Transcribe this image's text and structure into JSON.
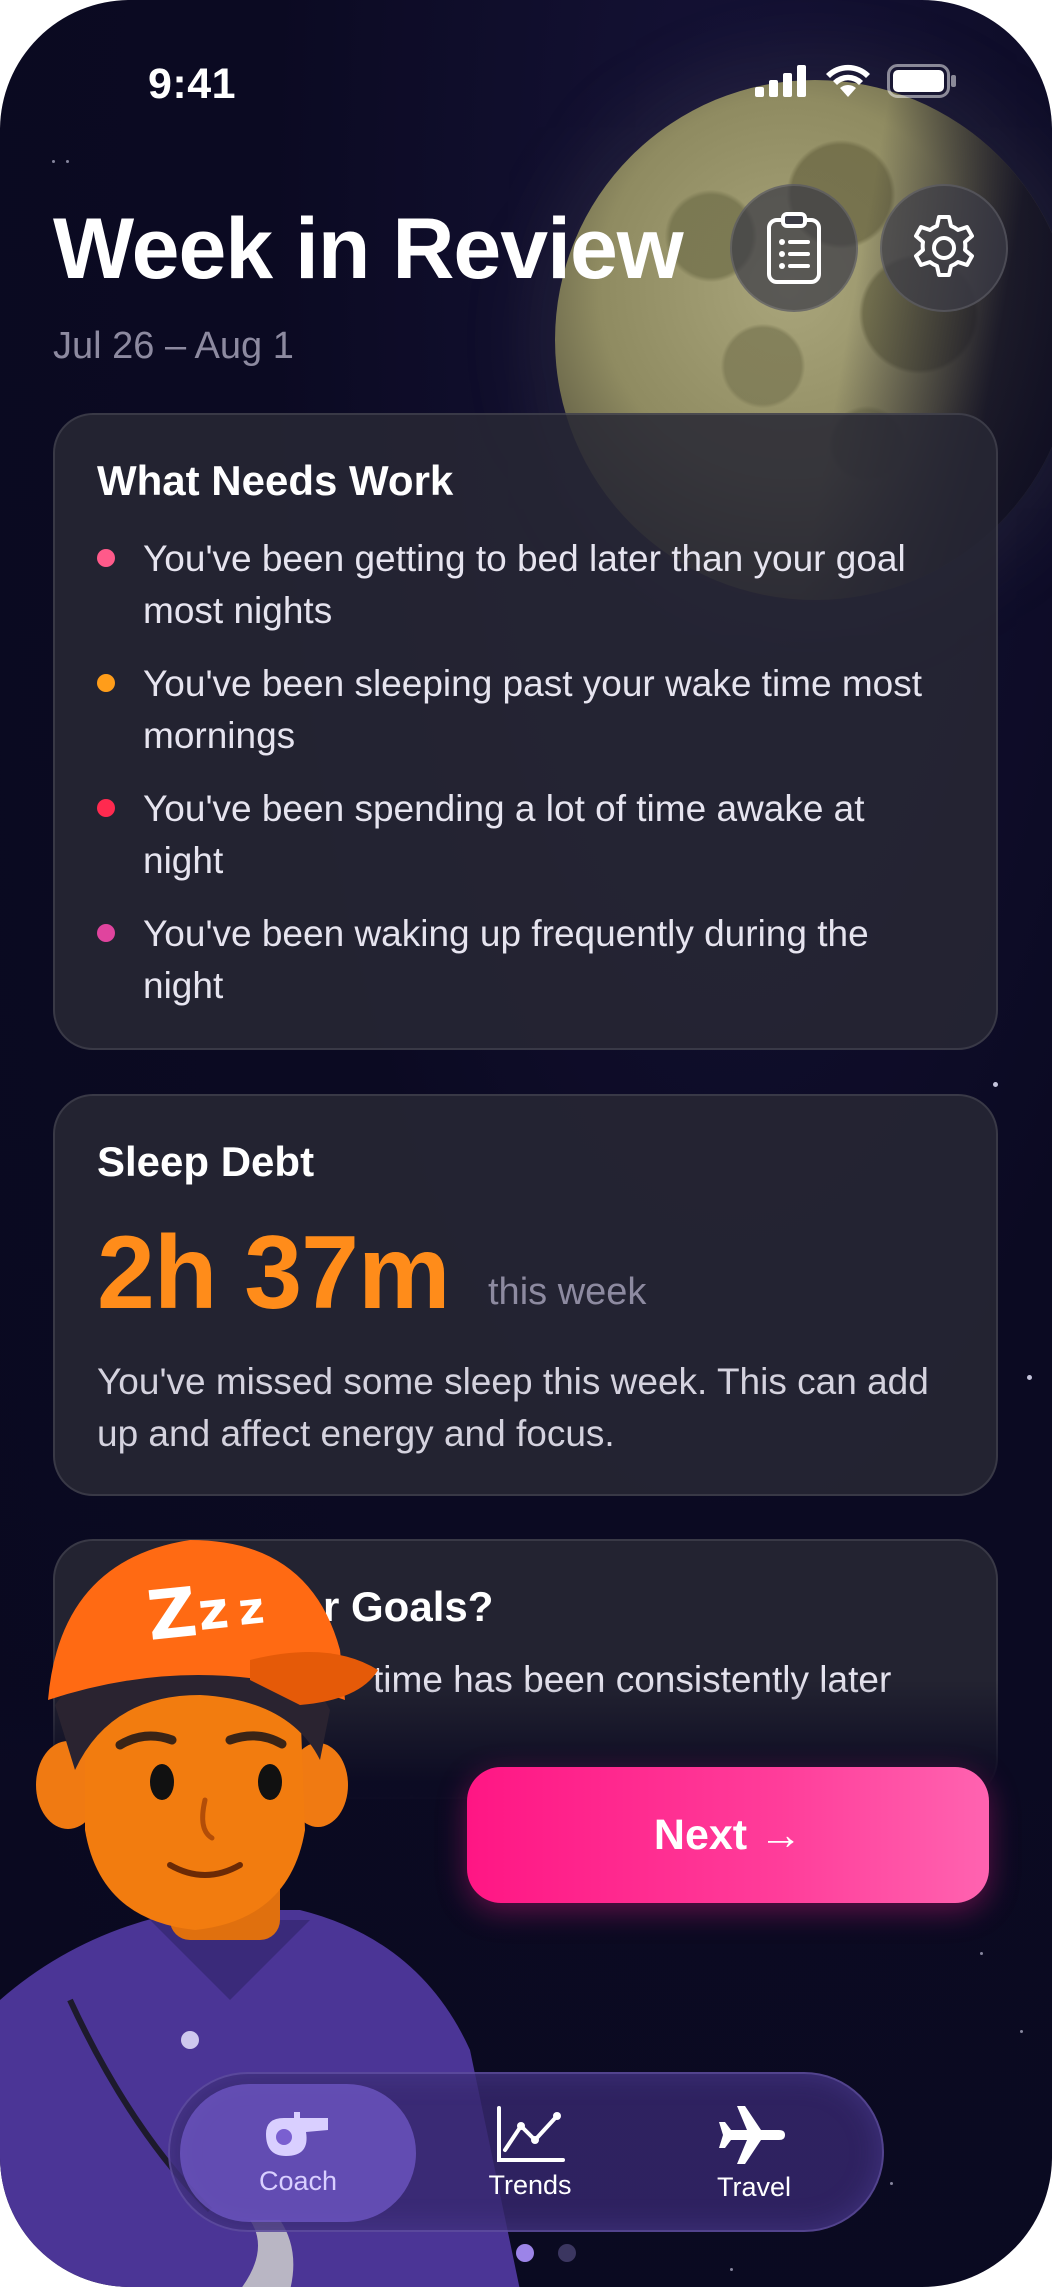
{
  "status_bar": {
    "time": "9:41"
  },
  "header": {
    "title": "Week in Review",
    "date_range": "Jul 26 – Aug 1"
  },
  "toolbar": {
    "report_icon": "clipboard-list-icon",
    "settings_icon": "gear-icon"
  },
  "needs_work": {
    "title": "What Needs Work",
    "items": [
      {
        "text": "You've been getting to bed later than your goal most nights",
        "color": "#ff5a8a"
      },
      {
        "text": "You've been sleeping past your wake time most mornings",
        "color": "#ff9d1a"
      },
      {
        "text": "You've been spending a lot of time awake at night",
        "color": "#ff2a4f"
      },
      {
        "text": "You've been waking up frequently during the night",
        "color": "#e0449e"
      }
    ]
  },
  "sleep_debt": {
    "title": "Sleep Debt",
    "value": "2h 37m",
    "unit": "this week",
    "description": "You've missed some sleep this week. This can add up and affect energy and focus.",
    "accent": "#ff8c1a"
  },
  "goals_card": {
    "title_partial": "r Goals?",
    "text_partial": "time has been consistently later"
  },
  "next_button": {
    "label": "Next →"
  },
  "tabs": [
    {
      "label": "Coach",
      "icon": "whistle-icon",
      "active": true
    },
    {
      "label": "Trends",
      "icon": "line-chart-icon",
      "active": false
    },
    {
      "label": "Travel",
      "icon": "airplane-icon",
      "active": false
    }
  ],
  "pagination": {
    "pages": 2,
    "current": 1
  }
}
